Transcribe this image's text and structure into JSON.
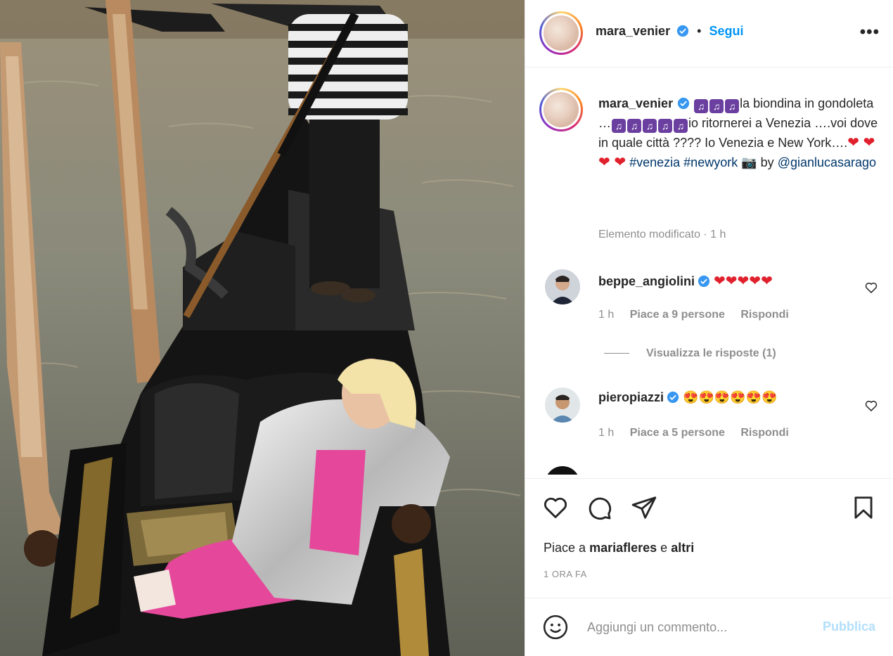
{
  "post": {
    "author": "mara_venier",
    "follow_label": "Segui",
    "more_label": "•••"
  },
  "caption": {
    "username": "mara_venier",
    "part1": "la biondina in gondoleta …",
    "part2": "io ritornerei a Venezia ….voi dove in quale città ????",
    "part3": "Io Venezia e New York….",
    "hashtag1": "#venezia",
    "hashtag2": "#newyork",
    "by": "by",
    "mention": "@gianlucasarago",
    "meta": "Elemento modificato · 1 h"
  },
  "comments": [
    {
      "username": "beppe_angiolini",
      "time": "1 h",
      "likes": "Piace a 9 persone",
      "reply": "Rispondi",
      "hearts": "❤❤❤❤❤"
    },
    {
      "username": "pieropiazzi",
      "time": "1 h",
      "likes": "Piace a 5 persone",
      "reply": "Rispondi",
      "emojis": "😍😍😍😍😍😍"
    }
  ],
  "view_replies": "Visualizza le risposte (1)",
  "likes": {
    "prefix": "Piace a",
    "user": "mariafleres",
    "conj": "e",
    "others": "altri"
  },
  "timestamp": "1 ORA FA",
  "comment_box": {
    "placeholder": "Aggiungi un commento...",
    "publish": "Pubblica"
  },
  "icons": {
    "like": "heart-icon",
    "comment": "comment-icon",
    "share": "share-icon",
    "save": "bookmark-icon",
    "emoji": "emoji-icon",
    "more": "more-icon"
  },
  "colors": {
    "link": "#0095f6",
    "hashtag": "#00376b",
    "muted": "#8e8e8e",
    "publish_disabled": "#b2dffc"
  }
}
